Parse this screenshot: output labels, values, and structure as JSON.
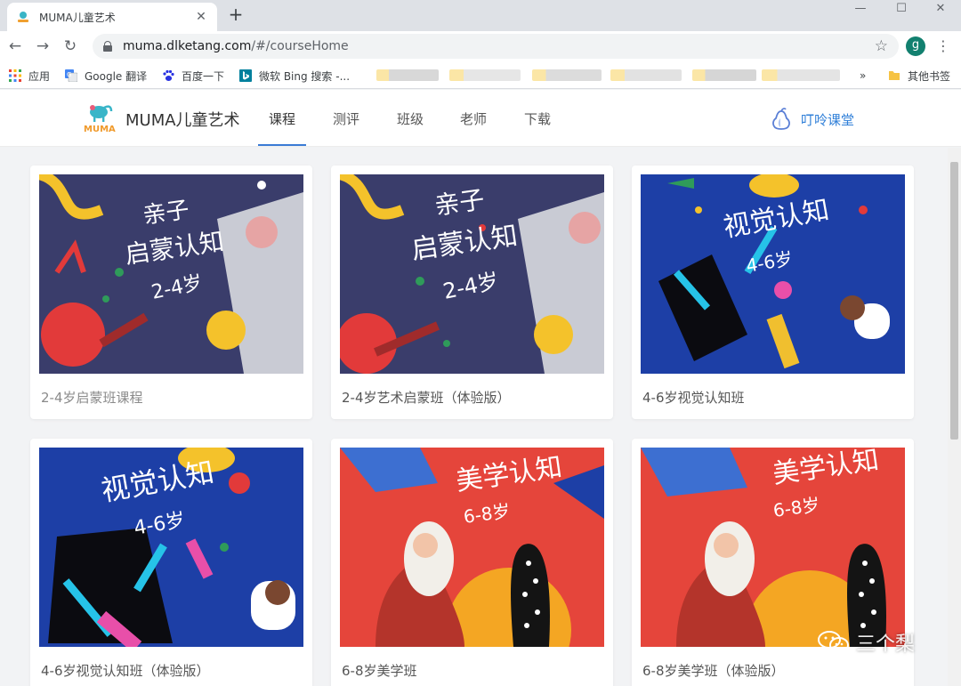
{
  "browser": {
    "tab_title": "MUMA儿童艺术",
    "url_host": "muma.dlketang.com",
    "url_path": "/#/courseHome",
    "profile_initial": "g",
    "bookmarks": [
      {
        "label": "应用",
        "icon": "apps-grid-icon"
      },
      {
        "label": "Google 翻译",
        "icon": "google-translate-icon"
      },
      {
        "label": "百度一下",
        "icon": "baidu-paw-icon"
      },
      {
        "label": "微软 Bing 搜索 -...",
        "icon": "bing-icon"
      }
    ],
    "bookmarks_overflow": "»",
    "other_bookmarks": "其他书签"
  },
  "site": {
    "logo_text": "MUMA",
    "brand": "MUMA儿童艺术",
    "nav": [
      "课程",
      "测评",
      "班级",
      "老师",
      "下载"
    ],
    "active_nav": "课程",
    "partner": "叮呤课堂"
  },
  "courses": [
    {
      "title": "2-4岁启蒙班课程",
      "cover_text": [
        "亲子",
        "启蒙认知",
        "2-4岁"
      ],
      "theme": "navy",
      "muted": true
    },
    {
      "title": "2-4岁艺术启蒙班（体验版）",
      "cover_text": [
        "亲子",
        "启蒙认知",
        "2-4岁"
      ],
      "theme": "navy",
      "muted": false
    },
    {
      "title": "4-6岁视觉认知班",
      "cover_text": [
        "视觉认知",
        "4-6岁"
      ],
      "theme": "blue",
      "muted": false
    },
    {
      "title": "4-6岁视觉认知班（体验版）",
      "cover_text": [
        "视觉认知",
        "4-6岁"
      ],
      "theme": "blue",
      "muted": false
    },
    {
      "title": "6-8岁美学班",
      "cover_text": [
        "美学认知",
        "6-8岁"
      ],
      "theme": "red",
      "muted": false
    },
    {
      "title": "6-8岁美学班（体验版）",
      "cover_text": [
        "美学认知",
        "6-8岁"
      ],
      "theme": "red",
      "muted": false
    }
  ],
  "watermark": "三个梨",
  "colors": {
    "accent": "#3a7bd5",
    "partner": "#2f7fd8",
    "navy_bg": "#3a3d6b",
    "blue_bg": "#1d3fa6",
    "red_bg": "#e5453b"
  }
}
